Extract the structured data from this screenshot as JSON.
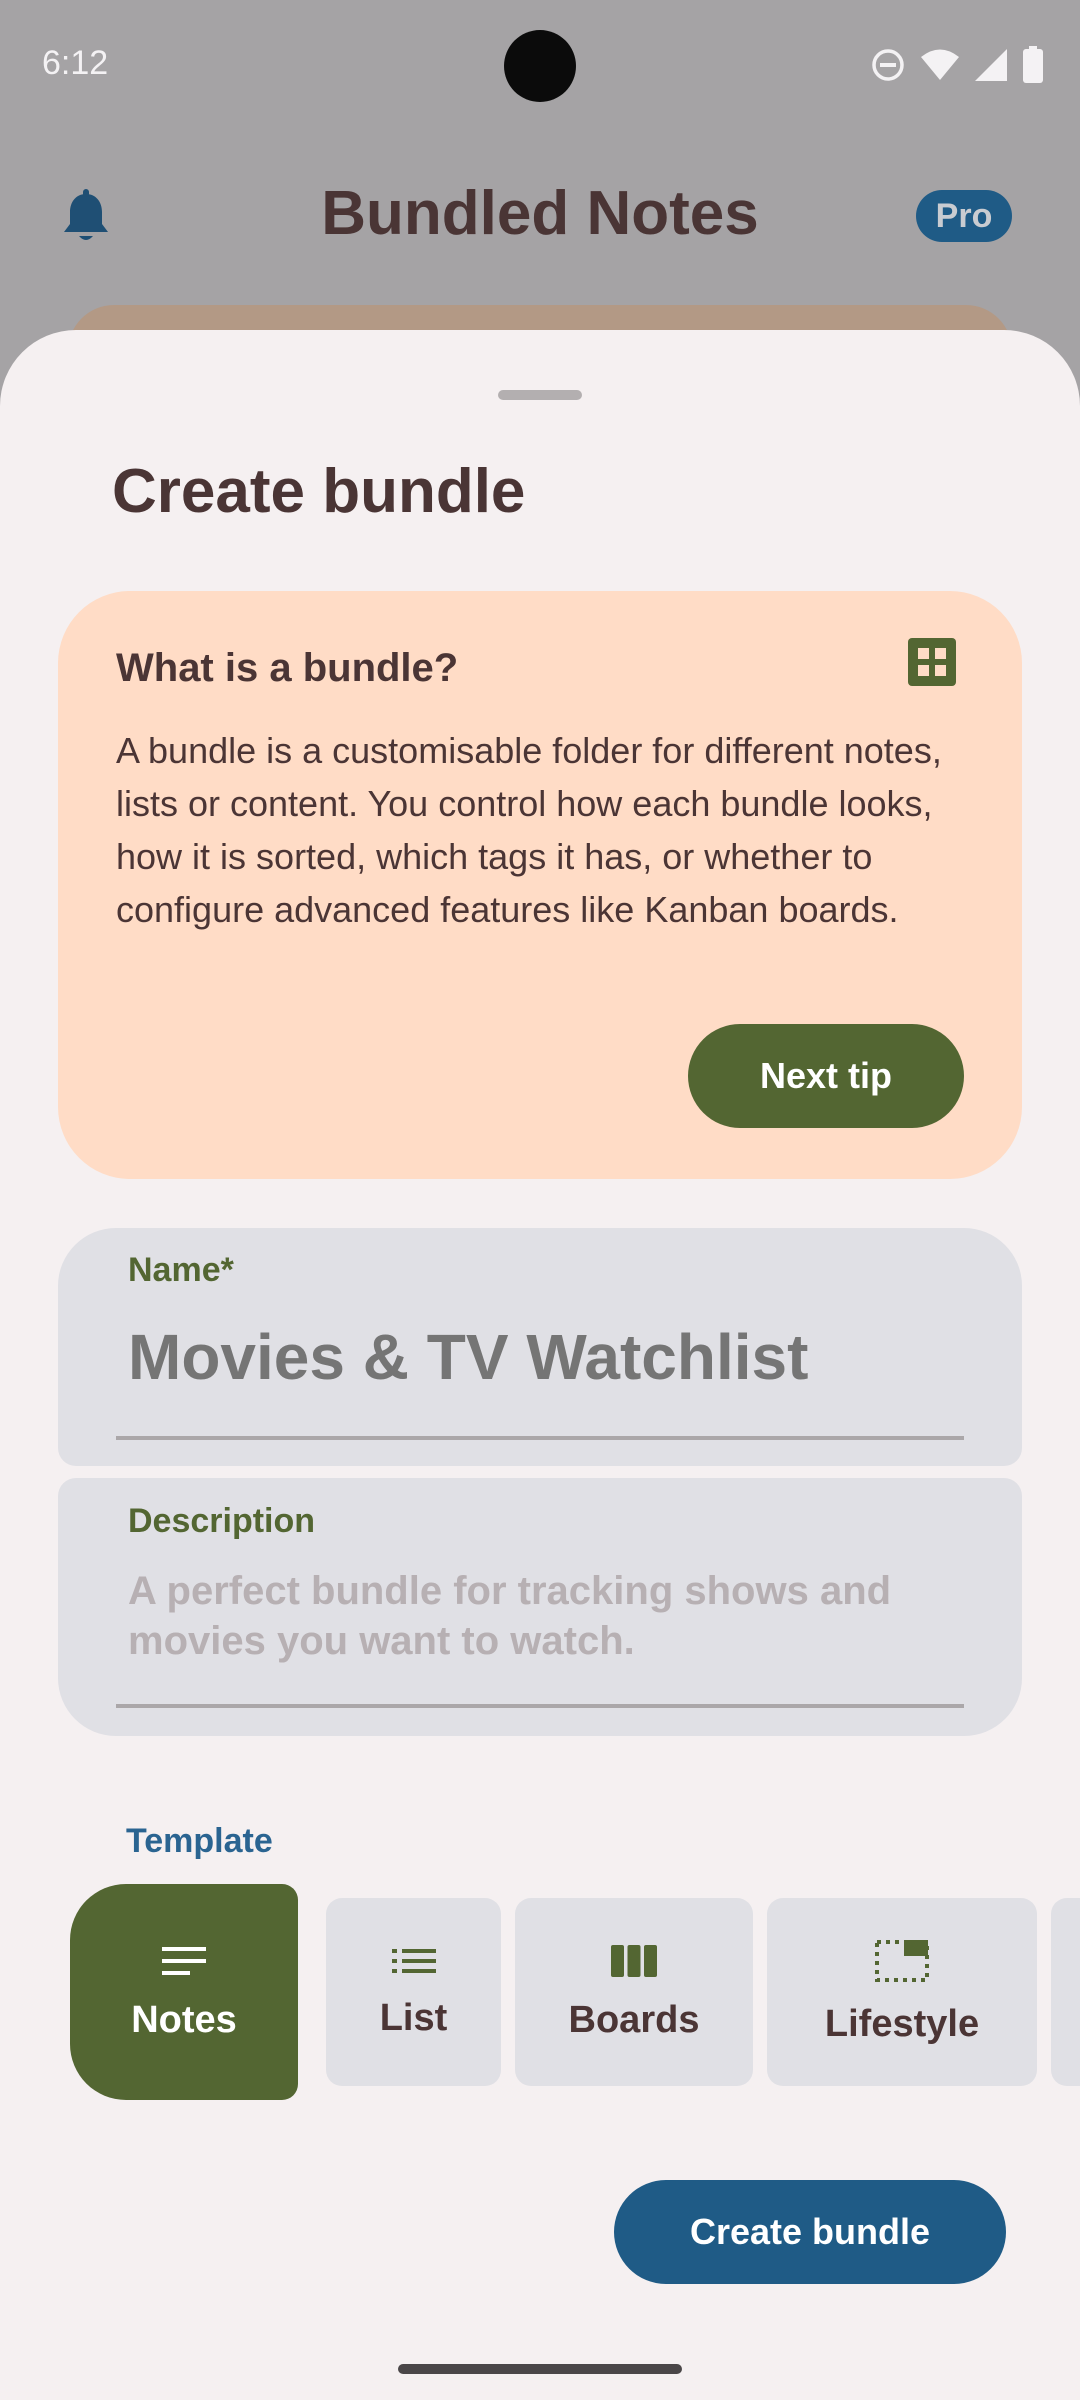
{
  "status_bar": {
    "time": "6:12",
    "icons": [
      "do-not-disturb-icon",
      "wifi-icon",
      "signal-icon",
      "battery-icon"
    ]
  },
  "app_bar": {
    "title": "Bundled Notes",
    "badge": "Pro",
    "left_icon": "bell-icon"
  },
  "sheet": {
    "title": "Create bundle",
    "tip": {
      "title": "What is a bundle?",
      "body": "A bundle is a customisable folder for different notes, lists or content. You control how each bundle looks, how it is sorted, which tags it has, or whether to configure advanced features like Kanban boards.",
      "button": "Next tip",
      "icon": "grid-icon"
    },
    "name_field": {
      "label": "Name*",
      "value": "",
      "placeholder": "Movies & TV Watchlist"
    },
    "description_field": {
      "label": "Description",
      "placeholder": "A perfect bundle for tracking shows and movies you want to watch."
    },
    "template": {
      "label": "Template",
      "options": [
        {
          "label": "Notes",
          "icon": "notes-icon",
          "selected": true
        },
        {
          "label": "List",
          "icon": "list-icon",
          "selected": false
        },
        {
          "label": "Boards",
          "icon": "boards-icon",
          "selected": false
        },
        {
          "label": "Lifestyle",
          "icon": "lifestyle-icon",
          "selected": false
        }
      ]
    },
    "create_button": "Create bundle"
  },
  "colors": {
    "scrim": "#a5a3a5",
    "sheet": "#f5f0f1",
    "primary_green": "#536632",
    "primary_blue": "#1f5b86",
    "tip_card": "#ffdcc6",
    "field": "#e0e0e5",
    "text_dark": "#4a3535"
  }
}
